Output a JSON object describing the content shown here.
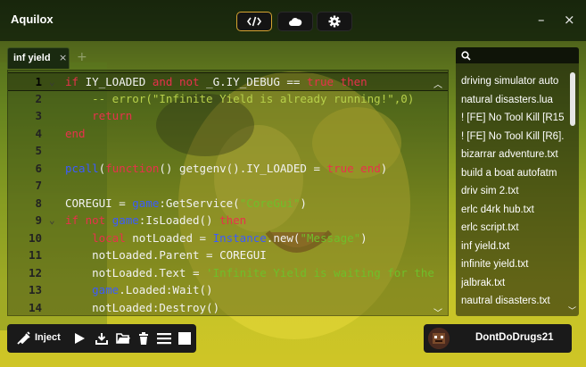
{
  "app": {
    "title": "Aquilox"
  },
  "titlebar": {
    "buttons": [
      {
        "name": "code-editor",
        "icon": "code-icon",
        "active": true
      },
      {
        "name": "cloud",
        "icon": "cloud-icon",
        "active": false
      },
      {
        "name": "settings",
        "icon": "gear-icon",
        "active": false
      }
    ],
    "minimize": "–",
    "close": "×"
  },
  "tabs": [
    {
      "label": "inf yield",
      "close": "×",
      "active": true
    }
  ],
  "tab_add": "+",
  "editor": {
    "current_line": 1,
    "lines": [
      {
        "n": "1",
        "fold": "⌄",
        "tokens": [
          [
            "kw",
            "if "
          ],
          [
            "id",
            "IY_LOADED "
          ],
          [
            "kw",
            "and not "
          ],
          [
            "id",
            "_G.IY_DEBUG "
          ],
          [
            "id",
            "== "
          ],
          [
            "kw",
            "true then"
          ]
        ]
      },
      {
        "n": "2",
        "fold": "",
        "tokens": [
          [
            "id",
            "    "
          ],
          [
            "err",
            "-- error(\"Infinite Yield is already running!\",0)"
          ]
        ]
      },
      {
        "n": "3",
        "fold": "",
        "tokens": [
          [
            "kw",
            "    return"
          ]
        ]
      },
      {
        "n": "4",
        "fold": "",
        "tokens": [
          [
            "kw",
            "end"
          ]
        ]
      },
      {
        "n": "5",
        "fold": "",
        "tokens": [
          [
            "id",
            ""
          ]
        ]
      },
      {
        "n": "6",
        "fold": "",
        "tokens": [
          [
            "fn",
            "pcall"
          ],
          [
            "id",
            "("
          ],
          [
            "kw",
            "function"
          ],
          [
            "id",
            "() getgenv().IY_LOADED = "
          ],
          [
            "kw",
            "true end"
          ],
          [
            "id",
            ")"
          ]
        ]
      },
      {
        "n": "7",
        "fold": "",
        "tokens": [
          [
            "id",
            ""
          ]
        ]
      },
      {
        "n": "8",
        "fold": "",
        "tokens": [
          [
            "id",
            "COREGUI = "
          ],
          [
            "fn",
            "game"
          ],
          [
            "id",
            ":GetService("
          ],
          [
            "str",
            "\"CoreGui\""
          ],
          [
            "id",
            ")"
          ]
        ]
      },
      {
        "n": "9",
        "fold": "⌄",
        "tokens": [
          [
            "kw",
            "if not "
          ],
          [
            "fn",
            "game"
          ],
          [
            "id",
            ":IsLoaded() "
          ],
          [
            "kw",
            "then"
          ]
        ]
      },
      {
        "n": "10",
        "fold": "",
        "tokens": [
          [
            "id",
            "    "
          ],
          [
            "kw",
            "local "
          ],
          [
            "id",
            "notLoaded = "
          ],
          [
            "fn",
            "Instance"
          ],
          [
            "id",
            ".new("
          ],
          [
            "str",
            "\"Message\""
          ],
          [
            "id",
            ")"
          ]
        ]
      },
      {
        "n": "11",
        "fold": "",
        "tokens": [
          [
            "id",
            "    notLoaded.Parent = COREGUI"
          ]
        ]
      },
      {
        "n": "12",
        "fold": "",
        "tokens": [
          [
            "id",
            "    notLoaded.Text = "
          ],
          [
            "str",
            "'Infinite Yield is waiting for the"
          ]
        ]
      },
      {
        "n": "13",
        "fold": "",
        "tokens": [
          [
            "id",
            "    "
          ],
          [
            "fn",
            "game"
          ],
          [
            "id",
            ".Loaded:Wait()"
          ]
        ]
      },
      {
        "n": "14",
        "fold": "",
        "tokens": [
          [
            "id",
            "    notLoaded:Destroy()"
          ]
        ]
      }
    ]
  },
  "scripts": {
    "search_placeholder": "",
    "files": [
      "driving simulator auto",
      "natural disasters.lua",
      "! [FE] No Tool Kill [R15",
      "! [FE] No Tool Kill [R6].",
      "bizarrar adventure.txt",
      "build a boat autofatm",
      "driv sim 2.txt",
      "erlc d4rk hub.txt",
      "erlc script.txt",
      "inf yield.txt",
      "infinite yield.txt",
      "jalbrak.txt",
      "nautral disasters.txt"
    ]
  },
  "toolbar": {
    "inject_label": "Inject",
    "buttons": [
      {
        "name": "execute-button",
        "icon": "play-icon"
      },
      {
        "name": "save-button",
        "icon": "download-icon"
      },
      {
        "name": "open-button",
        "icon": "folder-icon"
      },
      {
        "name": "clear-button",
        "icon": "trash-icon"
      },
      {
        "name": "list-button",
        "icon": "list-icon"
      },
      {
        "name": "stop-button",
        "icon": "stop-icon"
      }
    ]
  },
  "user": {
    "name": "DontDoDrugs21",
    "avatar": "avatar-icon"
  },
  "colors": {
    "accent": "#d6a431",
    "keyword": "#e8314c",
    "function": "#3b5bff",
    "string": "#6fbf2a"
  }
}
